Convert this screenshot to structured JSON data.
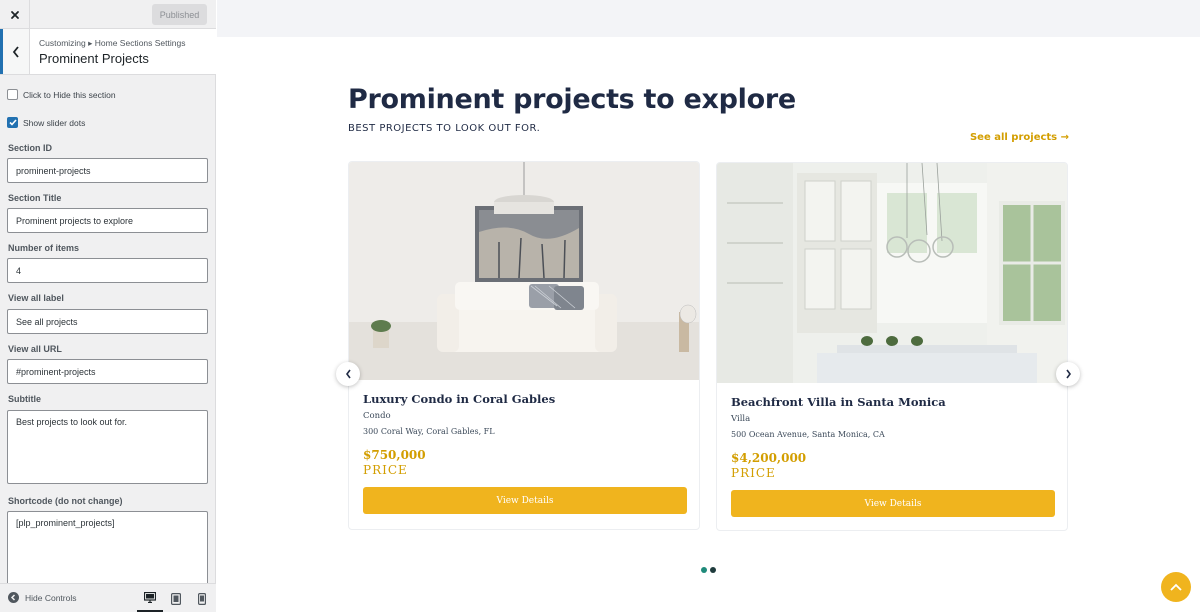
{
  "topbar": {
    "publish_label": "Published"
  },
  "section_head": {
    "breadcrumb": "Customizing ▸ Home Sections Settings",
    "title": "Prominent Projects"
  },
  "controls": {
    "hide_section_label": "Click to Hide this section",
    "hide_section_checked": false,
    "slider_dots_label": "Show slider dots",
    "slider_dots_checked": true,
    "section_id": {
      "label": "Section ID",
      "value": "prominent-projects"
    },
    "section_title": {
      "label": "Section Title",
      "value": "Prominent projects to explore"
    },
    "number_items": {
      "label": "Number of items",
      "value": "4"
    },
    "view_all_label": {
      "label": "View all label",
      "value": "See all projects"
    },
    "view_all_url": {
      "label": "View all URL",
      "value": "#prominent-projects"
    },
    "subtitle": {
      "label": "Subtitle",
      "value": "Best projects to look out for."
    },
    "shortcode": {
      "label": "Shortcode (do not change)",
      "value": "[plp_prominent_projects]"
    }
  },
  "footer": {
    "hide_controls_label": "Hide Controls",
    "active_device": "desktop"
  },
  "preview": {
    "title": "Prominent projects to explore",
    "subtitle": "BEST PROJECTS TO LOOK OUT FOR.",
    "see_all": "See all projects →",
    "cards": [
      {
        "name": "Luxury Condo in Coral Gables",
        "type": "Condo",
        "address": "300 Coral Way, Coral Gables, FL",
        "price": "$750,000",
        "price_label": "PRICE",
        "button": "View Details"
      },
      {
        "name": "Beachfront Villa in Santa Monica",
        "type": "Villa",
        "address": "500 Ocean Avenue, Santa Monica, CA",
        "price": "$4,200,000",
        "price_label": "PRICE",
        "button": "View Details"
      }
    ],
    "dots": {
      "count": 2,
      "active_index": 1
    },
    "colors": {
      "accent": "#f0b41e",
      "title": "#1f2a44",
      "link": "#d39e00",
      "dot_active": "#1f3b3d",
      "dot_inactive": "#1f8a7a",
      "customizer_blue": "#2271b1"
    }
  }
}
